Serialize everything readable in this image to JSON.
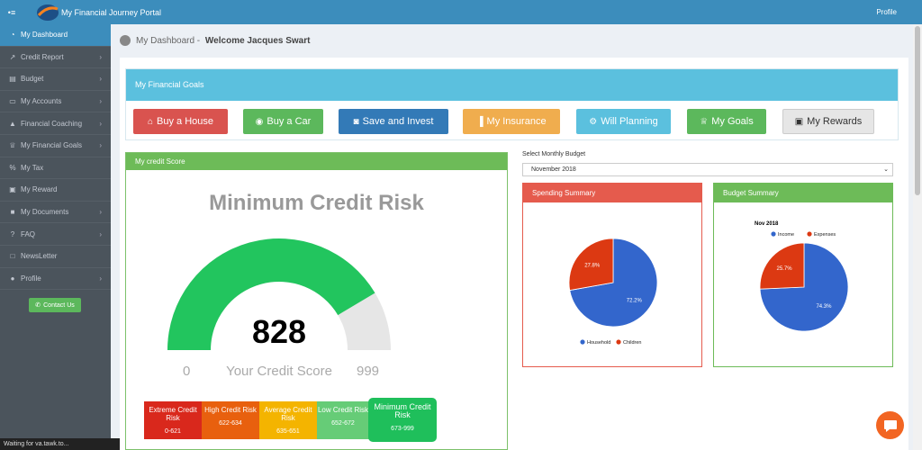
{
  "header": {
    "brand": "My Financial Journey Portal",
    "profile": "Profile",
    "menu_icon": "hamburger-icon"
  },
  "sidebar": {
    "items": [
      {
        "label": "My Dashboard",
        "icon": "dashboard-icon",
        "active": true,
        "chevron": false
      },
      {
        "label": "Credit Report",
        "icon": "line-chart-icon",
        "chevron": true
      },
      {
        "label": "Budget",
        "icon": "briefcase-icon",
        "chevron": true
      },
      {
        "label": "My Accounts",
        "icon": "credit-card-icon",
        "chevron": true
      },
      {
        "label": "Financial Coaching",
        "icon": "graduation-cap-icon",
        "chevron": true
      },
      {
        "label": "My Financial Goals",
        "icon": "trophy-icon",
        "chevron": true
      },
      {
        "label": "My Tax",
        "icon": "percent-icon",
        "chevron": false
      },
      {
        "label": "My Reward",
        "icon": "wallet-icon",
        "chevron": false
      },
      {
        "label": "My Documents",
        "icon": "folder-icon",
        "chevron": true
      },
      {
        "label": "FAQ",
        "icon": "question-icon",
        "chevron": true
      },
      {
        "label": "NewsLetter",
        "icon": "document-icon",
        "chevron": false
      },
      {
        "label": "Profile",
        "icon": "user-icon",
        "chevron": true
      }
    ],
    "contact_button": "Contact Us"
  },
  "status_bar": "Waiting for va.tawk.to...",
  "page": {
    "section": "My Dashboard",
    "separator": " - ",
    "welcome": "Welcome Jacques Swart"
  },
  "goals": {
    "title": "My Financial Goals",
    "buttons": [
      {
        "label": "Buy a House",
        "icon": "home-icon",
        "color": "#d9534f"
      },
      {
        "label": "Buy a Car",
        "icon": "car-icon",
        "color": "#5cb85c"
      },
      {
        "label": "Save and Invest",
        "icon": "piggy-bank-icon",
        "color": "#337ab7"
      },
      {
        "label": "My Insurance",
        "icon": "bar-chart-icon",
        "color": "#f0ad4e"
      },
      {
        "label": "Will Planning",
        "icon": "gear-icon",
        "color": "#5bc0de"
      },
      {
        "label": "My Goals",
        "icon": "trophy-icon",
        "color": "#5cb85c"
      },
      {
        "label": "My Rewards",
        "icon": "wallet-icon",
        "color": "#e6e6e6"
      }
    ]
  },
  "credit": {
    "panel_title": "My credit Score",
    "rating": "Minimum Credit Risk",
    "score": "828",
    "score_label": "Your Credit Score",
    "min": "0",
    "max": "999",
    "score_value": 828,
    "score_max": 999,
    "gauge_color": "#22c55e",
    "bands": [
      {
        "name": "Extreme Credit Risk",
        "range": "0-621",
        "color": "#d9281c"
      },
      {
        "name": "High Credit Risk",
        "range": "622-634",
        "color": "#e8600e"
      },
      {
        "name": "Average Credit Risk",
        "range": "635-651",
        "color": "#f4b400"
      },
      {
        "name": "Low Credit Risk",
        "range": "652-672",
        "color": "#66cc77"
      },
      {
        "name": "Minimum Credit Risk",
        "range": "673-999",
        "color": "#1fbf5b",
        "highlight": true
      }
    ]
  },
  "budget": {
    "select_label": "Select Monthly Budget",
    "selected": "November 2018"
  },
  "chart_data": [
    {
      "type": "pie",
      "title": "Spending Summary",
      "categories": [
        "Household",
        "Children"
      ],
      "values": [
        72.2,
        27.8
      ],
      "colors": [
        "#3366cc",
        "#dc3912"
      ],
      "legend": "bottom",
      "header_color": "#e55b4d"
    },
    {
      "type": "pie",
      "title": "Budget Summary",
      "subtitle": "Nov 2018",
      "categories": [
        "Income",
        "Expenses"
      ],
      "values": [
        74.3,
        25.7
      ],
      "colors": [
        "#3366cc",
        "#dc3912"
      ],
      "legend": "top",
      "header_color": "#6dbb58"
    }
  ]
}
